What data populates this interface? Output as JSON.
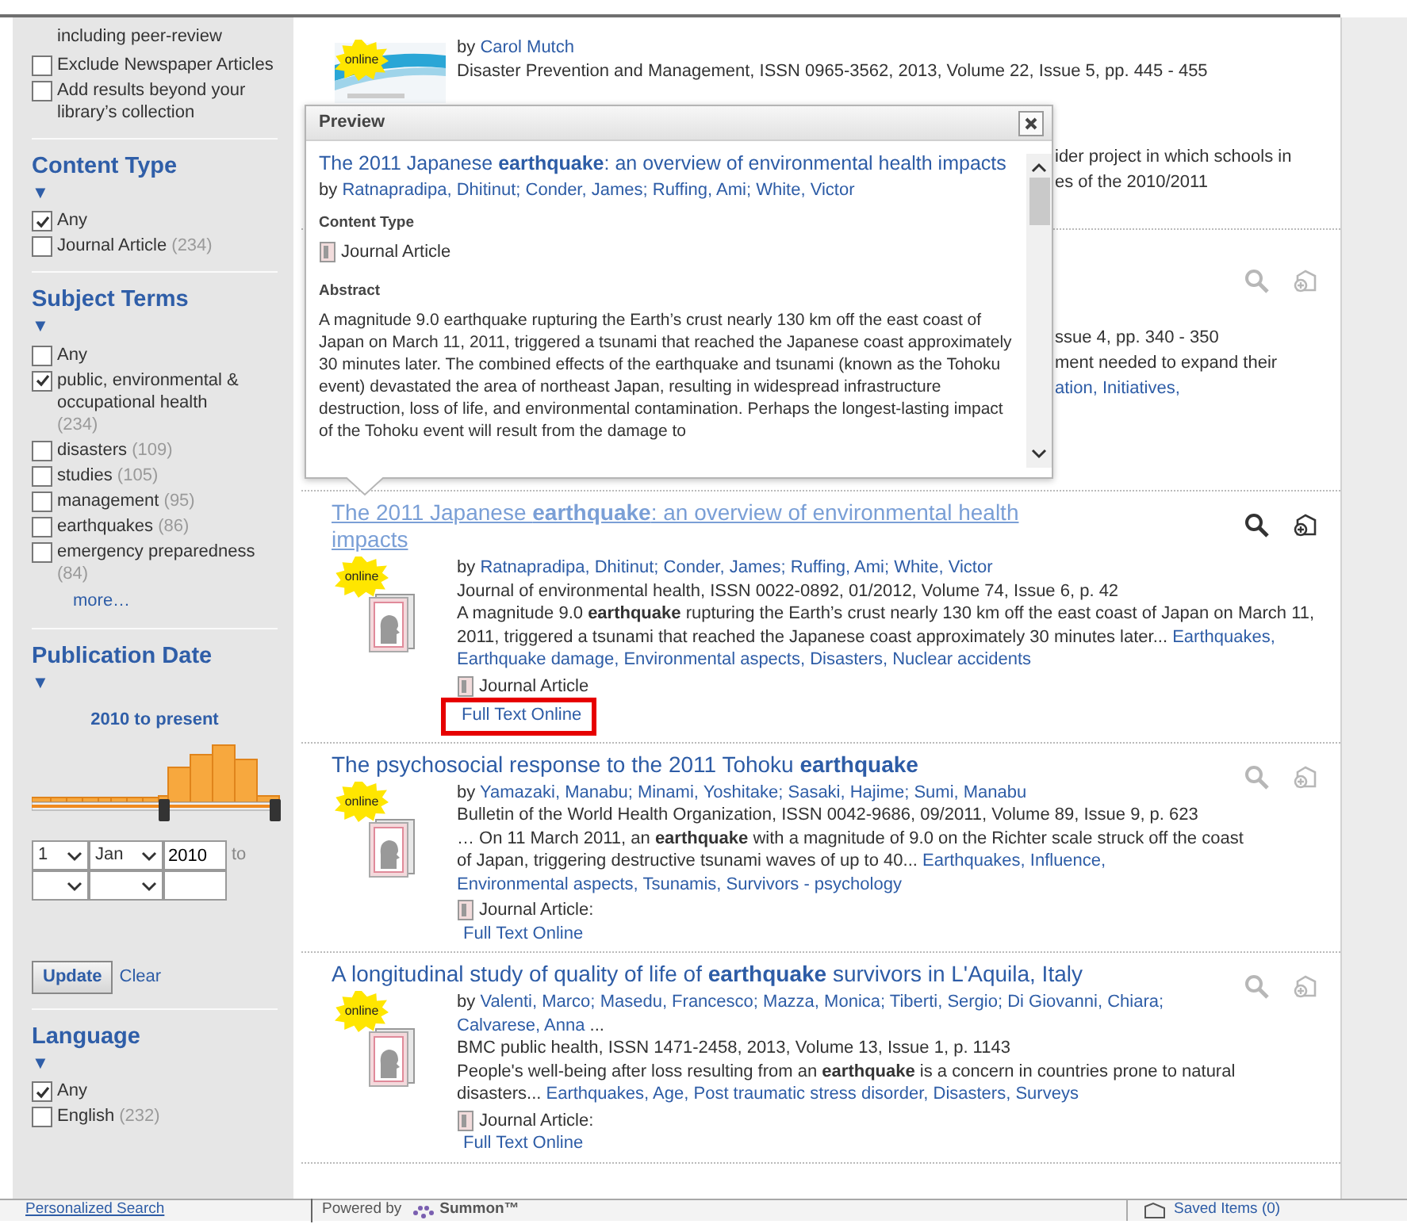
{
  "sidebar": {
    "top_note": "including peer-review",
    "options": [
      {
        "label": "Exclude Newspaper Articles",
        "checked": false
      },
      {
        "label": "Add results beyond your library’s collection",
        "checked": false
      }
    ],
    "sections": [
      {
        "kind": "checklist",
        "title": "Content Type",
        "toggle": "▼",
        "items": [
          {
            "label": "Any",
            "checked": true
          },
          {
            "label": "Journal Article",
            "count": "(234)",
            "checked": false
          }
        ]
      },
      {
        "kind": "checklist",
        "title": "Subject Terms",
        "toggle": "▼",
        "items": [
          {
            "label": "Any",
            "checked": false
          },
          {
            "label": "public, environmental & occupational health",
            "count": "(234)",
            "checked": true
          },
          {
            "label": "disasters",
            "count": "(109)",
            "checked": false
          },
          {
            "label": "studies",
            "count": "(105)",
            "checked": false
          },
          {
            "label": "management",
            "count": "(95)",
            "checked": false
          },
          {
            "label": "earthquakes",
            "count": "(86)",
            "checked": false
          },
          {
            "label": "emergency preparedness",
            "count": "(84)",
            "checked": false
          }
        ],
        "more": "more…"
      },
      {
        "kind": "date",
        "title": "Publication Date",
        "toggle": "▼",
        "range_label": "2010 to present",
        "from": {
          "day": "1",
          "month": "Jan",
          "year": "2010"
        },
        "to_label": "to",
        "update": "Update",
        "clear": "Clear"
      },
      {
        "kind": "checklist",
        "title": "Language",
        "toggle": "▼",
        "items": [
          {
            "label": "Any",
            "checked": true
          },
          {
            "label": "English",
            "count": "(232)",
            "checked": false
          }
        ]
      }
    ]
  },
  "results": [
    {
      "kind": "covered_top",
      "badge": "online",
      "by": "by",
      "authors": [
        "Carol Mutch"
      ],
      "source": "Disaster Prevention and Management, ISSN 0965-3562, 2013, Volume 22, Issue 5, pp. 445 - 455",
      "fragments": [
        {
          "parts": [
            {
              "text": "ider project in which schools in",
              "link": false
            }
          ]
        },
        {
          "parts": [
            {
              "text": "es of the 2010/2011",
              "link": false
            }
          ]
        }
      ]
    },
    {
      "kind": "covered",
      "hover": false,
      "fragments": [
        {
          "parts": [
            {
              "text": "ssue 4, pp. 340 - 350",
              "link": false
            }
          ]
        },
        {
          "parts": [
            {
              "text": "ment needed to expand their",
              "link": false
            }
          ]
        },
        {
          "parts": [
            {
              "text": "ation,",
              "link": true
            },
            {
              "text": "Initiatives,",
              "link": true
            }
          ]
        }
      ]
    },
    {
      "kind": "full",
      "hover": true,
      "badge": "online",
      "title": "The 2011 Japanese **earthquake**: an overview of environmental health impacts",
      "by": "by",
      "authors": [
        "Ratnapradipa, Dhitinut;",
        "Conder, James;",
        "Ruffing, Ami;",
        "White, Victor"
      ],
      "source": "Journal of environmental health, ISSN 0022-0892, 01/2012, Volume 74, Issue 6, p. 42",
      "abstract": "A magnitude 9.0 **earthquake** rupturing the Earth’s crust nearly 130 km off the east coast of Japan on March 11, 2011, triggered a tsunami that reached the Japanese coast approximately 30 minutes later...",
      "subjects": [
        "Earthquakes,",
        "Earthquake damage,",
        "Environmental aspects,",
        "Disasters,",
        "Nuclear accidents"
      ],
      "content_type": "Journal Article",
      "full_text": "Full Text Online"
    },
    {
      "kind": "full",
      "hover": false,
      "badge": "online",
      "title": "The psychosocial response to the 2011 Tohoku **earthquake**",
      "by": "by",
      "authors": [
        "Yamazaki, Manabu;",
        "Minami, Yoshitake;",
        "Sasaki, Hajime;",
        "Sumi, Manabu"
      ],
      "source": "Bulletin of the World Health Organization, ISSN 0042-9686, 09/2011, Volume 89, Issue 9, p. 623",
      "abstract": "…  On 11 March 2011, an **earthquake** with a magnitude of 9.0 on the Richter scale struck off the coast of Japan, triggering destructive tsunami waves of up to 40...",
      "subjects": [
        "Earthquakes,",
        "Influence,",
        "Environmental aspects,",
        "Tsunamis,",
        "Survivors - psychology"
      ],
      "content_type": "Journal Article:",
      "full_text": "Full Text Online"
    },
    {
      "kind": "full",
      "hover": false,
      "badge": "online",
      "title": "A longitudinal study of quality of life of **earthquake** survivors in L'Aquila, Italy",
      "by": "by",
      "authors": [
        "Valenti, Marco;",
        "Masedu, Francesco;",
        "Mazza, Monica;",
        "Tiberti, Sergio;",
        "Di Giovanni, Chiara;",
        "Calvarese, Anna"
      ],
      "authors_more": "...",
      "source": "BMC public health, ISSN 1471-2458, 2013, Volume 13, Issue 1, p. 1143",
      "abstract": "People's well-being after loss resulting from an **earthquake** is a concern in countries prone to natural disasters...",
      "subjects": [
        "Earthquakes,",
        "Age,",
        "Post traumatic stress disorder,",
        "Disasters,",
        "Surveys"
      ],
      "content_type": "Journal Article:",
      "full_text": "Full Text Online"
    }
  ],
  "preview": {
    "title": "Preview",
    "doc_title": "The 2011 Japanese **earthquake**: an overview of environmental health impacts",
    "by": "by",
    "authors": [
      "Ratnapradipa, Dhitinut;",
      "Conder, James;",
      "Ruffing, Ami;",
      "White, Victor"
    ],
    "content_type_label": "Content Type",
    "content_type": "Journal Article",
    "abstract_label": "Abstract",
    "abstract": "A magnitude 9.0 earthquake rupturing the Earth’s crust nearly 130 km off the east coast of Japan on March 11, 2011, triggered a tsunami that reached the Japanese coast approximately 30 minutes later. The combined effects of the earthquake and tsunami (known as the Tohoku event) devastated the area of northeast Japan, resulting in widespread infrastructure destruction, loss of life, and environmental contamination. Perhaps the longest-lasting impact of the Tohoku event will result from the damage to"
  },
  "footer": {
    "personalized": "Personalized Search",
    "powered_by": "Powered by",
    "brand": "Summon™",
    "saved": "Saved Items (0)"
  }
}
